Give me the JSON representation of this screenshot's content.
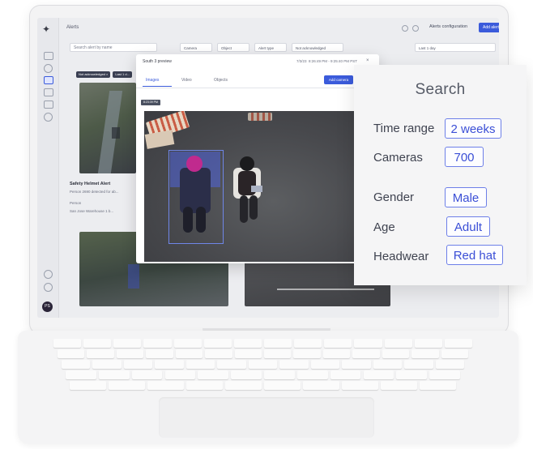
{
  "app": {
    "title": "Alerts",
    "alerts_config_label": "Alerts configuration",
    "add_alert_label": "Add alert"
  },
  "filters": {
    "search_placeholder": "Search alert by name",
    "dropdowns": [
      "Camera",
      "Object",
      "Alert type",
      "Not acknowledged",
      "Last 1 day"
    ]
  },
  "chips": [
    "Not acknowledged ×",
    "Last 1 d..."
  ],
  "alert_card": {
    "title": "Safety Helmet Alert",
    "subtitle": "Person 2690 detected for ab...",
    "meta1": "Person",
    "meta2": "San Jose Warehouse 1 b..."
  },
  "modal": {
    "title": "South 3 preview",
    "time_prefix": "7/3/23",
    "time_range": "8:26:49 PM - 9:25:40 PM PST",
    "tabs": [
      "Images",
      "Video",
      "Objects"
    ],
    "add_camera_label": "Add camera",
    "frame_tag": "8:23:39 PM"
  },
  "search_panel": {
    "title": "Search",
    "rows": [
      {
        "label": "Time range",
        "value": "2 weeks"
      },
      {
        "label": "Cameras",
        "value": "700"
      },
      {
        "label": "Gender",
        "value": "Male"
      },
      {
        "label": "Age",
        "value": "Adult"
      },
      {
        "label": "Headwear",
        "value": "Red hat"
      }
    ]
  },
  "user": {
    "initials": "PS"
  },
  "colors": {
    "accent": "#3b5bdb",
    "panel_bg": "#f5f5f6",
    "value_border": "#6d7fe8"
  }
}
